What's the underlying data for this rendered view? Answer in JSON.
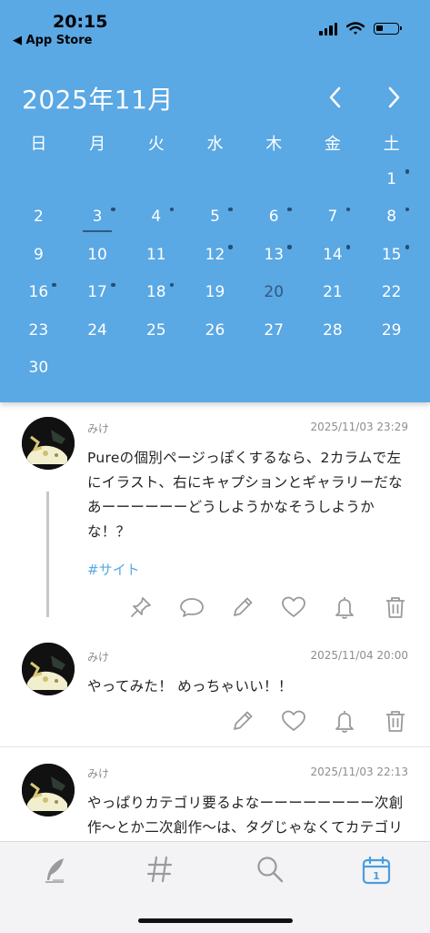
{
  "status_bar": {
    "time": "20:15",
    "back_label": "◀ App Store",
    "battery_level": 0.35
  },
  "calendar": {
    "month_title": "2025年11月",
    "weekdays": [
      "日",
      "月",
      "火",
      "水",
      "木",
      "金",
      "土"
    ],
    "days": [
      {
        "day": "",
        "dot": false
      },
      {
        "day": "",
        "dot": false
      },
      {
        "day": "",
        "dot": false
      },
      {
        "day": "",
        "dot": false
      },
      {
        "day": "",
        "dot": false
      },
      {
        "day": "",
        "dot": false
      },
      {
        "day": "1",
        "dot": true
      },
      {
        "day": "2",
        "dot": false
      },
      {
        "day": "3",
        "dot": true,
        "selected": true
      },
      {
        "day": "4",
        "dot": true
      },
      {
        "day": "5",
        "dot": true
      },
      {
        "day": "6",
        "dot": true
      },
      {
        "day": "7",
        "dot": true
      },
      {
        "day": "8",
        "dot": true
      },
      {
        "day": "9",
        "dot": false
      },
      {
        "day": "10",
        "dot": false
      },
      {
        "day": "11",
        "dot": false
      },
      {
        "day": "12",
        "dot": true
      },
      {
        "day": "13",
        "dot": true
      },
      {
        "day": "14",
        "dot": true
      },
      {
        "day": "15",
        "dot": true
      },
      {
        "day": "16",
        "dot": true
      },
      {
        "day": "17",
        "dot": true
      },
      {
        "day": "18",
        "dot": true
      },
      {
        "day": "19",
        "dot": false
      },
      {
        "day": "20",
        "dot": false,
        "today": true
      },
      {
        "day": "21",
        "dot": false
      },
      {
        "day": "22",
        "dot": false
      },
      {
        "day": "23",
        "dot": false
      },
      {
        "day": "24",
        "dot": false
      },
      {
        "day": "25",
        "dot": false
      },
      {
        "day": "26",
        "dot": false
      },
      {
        "day": "27",
        "dot": false
      },
      {
        "day": "28",
        "dot": false
      },
      {
        "day": "29",
        "dot": false
      },
      {
        "day": "30",
        "dot": false
      }
    ]
  },
  "posts": [
    {
      "author": "みけ",
      "datetime": "2025/11/03 23:29",
      "body": "Pureの個別ページっぽくするなら、2カラムで左にイラスト、右にキャプションとギャラリーだなあーーーーーーどうしようかなそうしようかな！？",
      "tag": "#サイト"
    },
    {
      "author": "みけ",
      "datetime": "2025/11/04 20:00",
      "body": "やってみた！ めっちゃいい！！"
    },
    {
      "author": "みけ",
      "datetime": "2025/11/03 22:13",
      "body": "やっぱりカテゴリ要るよなーーーーーーーー次創作〜とか二次創作〜は、タグじゃなくてカテゴリのほうがスムーズっぽい……タグは作品名と登場人物名に使うとか"
    }
  ],
  "icons": {
    "nav": [
      "chevron-left",
      "chevron-right"
    ],
    "actions": [
      "pin",
      "comment",
      "edit",
      "heart",
      "bell",
      "trash"
    ],
    "tabs": [
      "quill",
      "hashtag",
      "search",
      "calendar"
    ]
  },
  "tabbar": {
    "calendar_icon_day": "1",
    "active_tab": "calendar"
  },
  "colors": {
    "header_blue": "#5aa8e4",
    "dot": "#234e78",
    "active_tab": "#4a9de0",
    "inactive_tab": "#9a9a9a"
  }
}
